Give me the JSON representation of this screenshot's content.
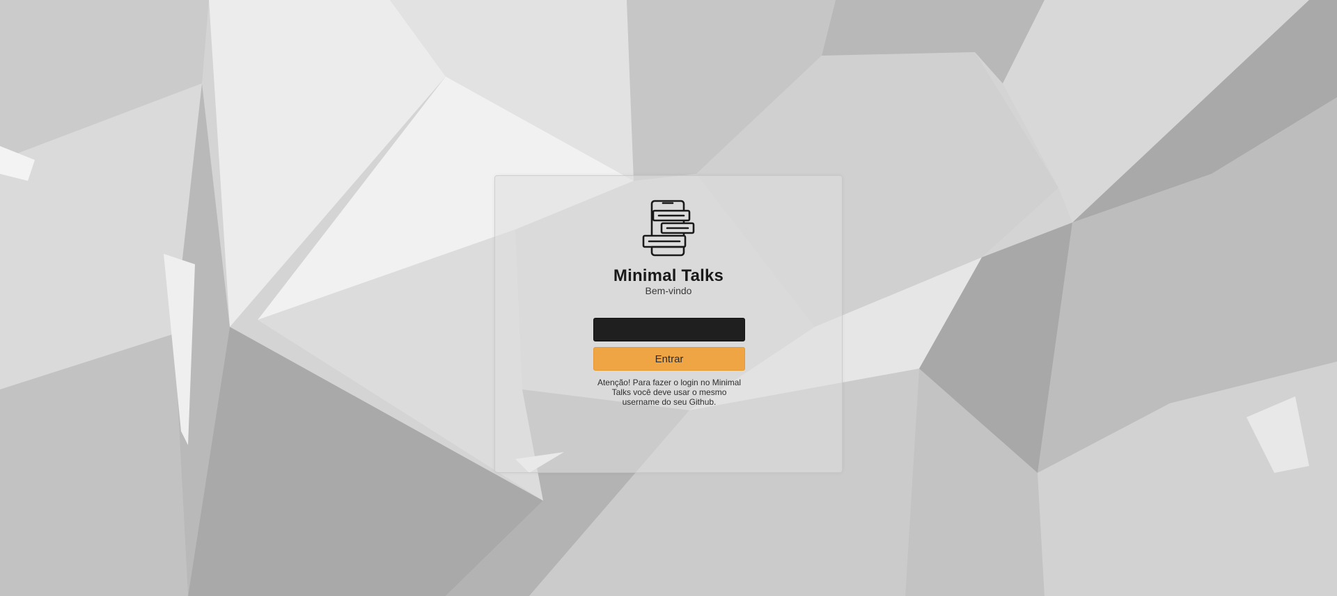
{
  "app": {
    "title": "Minimal Talks",
    "subtitle": "Bem-vindo",
    "logo_icon": "chat-phone-icon"
  },
  "login": {
    "username_placeholder": "",
    "username_value": "",
    "submit_label": "Entrar",
    "notice": "Atenção! Para fazer o login no Minimal Talks você deve usar o mesmo username do seu Github."
  },
  "colors": {
    "accent": "#efa543",
    "input_bg": "#1f1f1f",
    "card_bg": "#dedede",
    "background": "#d6d6d6"
  }
}
